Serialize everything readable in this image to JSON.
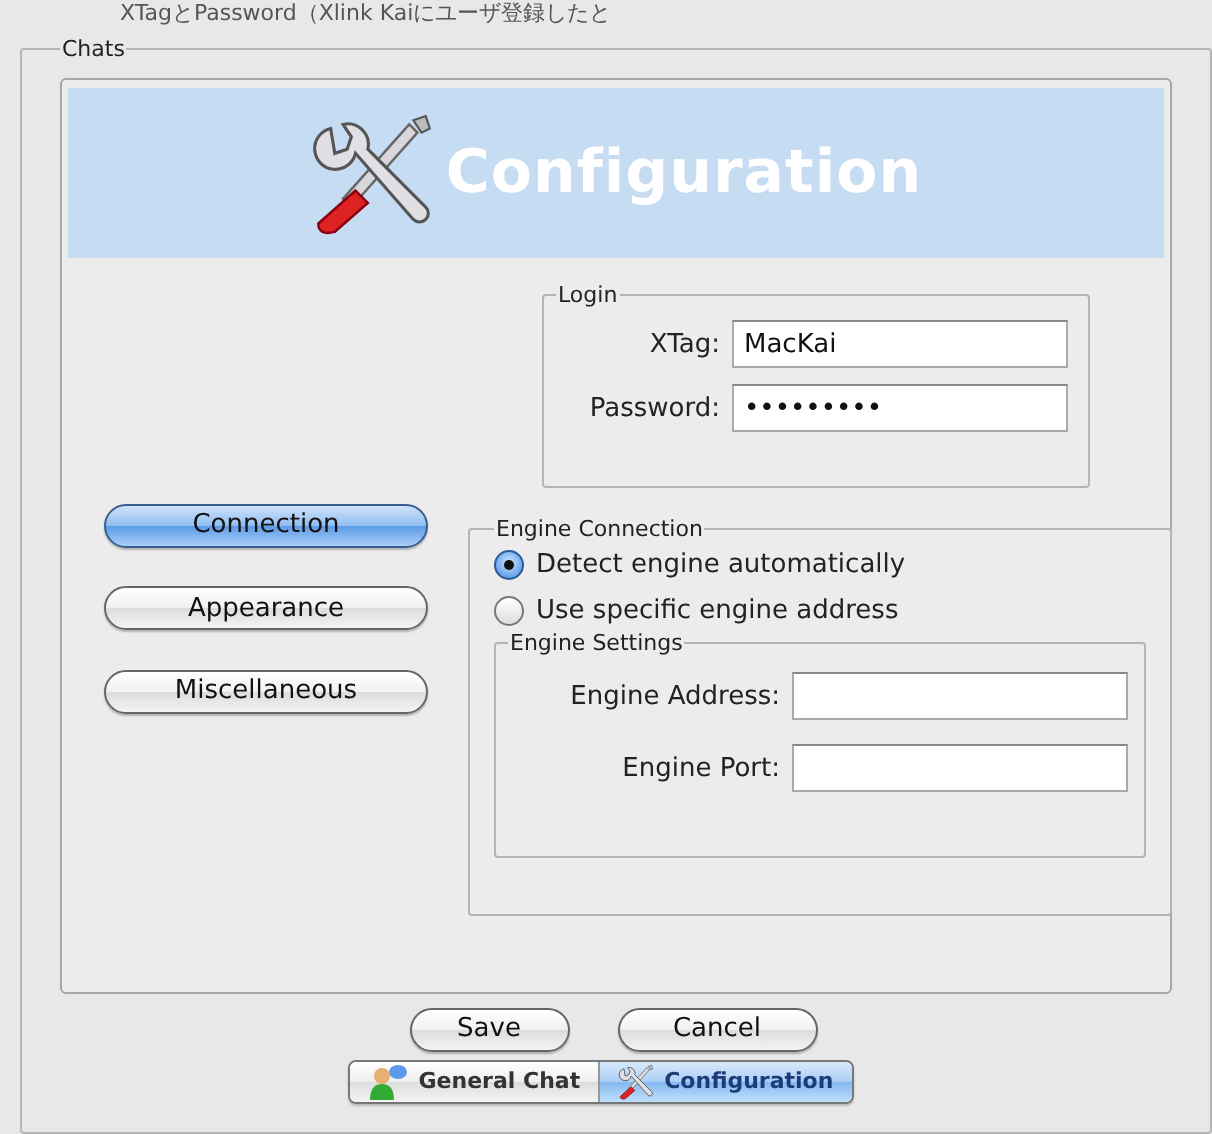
{
  "caption": "XTagとPassword（Xlink Kaiにユーザ登録したと",
  "group": {
    "title": "Chats"
  },
  "header": {
    "title": "Configuration"
  },
  "nav": [
    {
      "label": "Connection",
      "selected": true
    },
    {
      "label": "Appearance",
      "selected": false
    },
    {
      "label": "Miscellaneous",
      "selected": false
    }
  ],
  "login": {
    "title": "Login",
    "fields": [
      {
        "label": "XTag:",
        "value": "MacKai"
      },
      {
        "label": "Password:",
        "value": "•••••••••"
      }
    ]
  },
  "engine_connection": {
    "title": "Engine Connection",
    "options": [
      {
        "label": "Detect engine automatically",
        "selected": true
      },
      {
        "label": "Use specific engine address",
        "selected": false
      }
    ],
    "settings": {
      "title": "Engine Settings",
      "fields": [
        {
          "label": "Engine Address:"
        },
        {
          "label": "Engine Port:"
        }
      ]
    }
  },
  "buttons": [
    "Save",
    "Cancel"
  ],
  "tabs": [
    {
      "label": "General Chat",
      "selected": false
    },
    {
      "label": "Configuration",
      "selected": true
    }
  ]
}
